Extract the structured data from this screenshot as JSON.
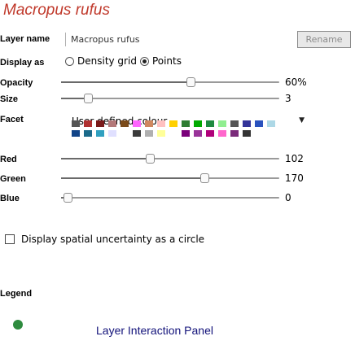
{
  "header": {
    "title": "Macropus rufus"
  },
  "layer_name": {
    "label": "Layer name",
    "value": "Macropus rufus",
    "rename_label": "Rename"
  },
  "display_as": {
    "label": "Display as",
    "options": [
      {
        "label": "Density grid",
        "checked": false
      },
      {
        "label": "Points",
        "checked": true
      }
    ]
  },
  "opacity": {
    "label": "Opacity",
    "value_text": "60%",
    "fraction": 0.6
  },
  "size": {
    "label": "Size",
    "value_text": "3",
    "fraction": 0.1
  },
  "facet": {
    "label": "Facet",
    "selected": "User defined colour"
  },
  "palette": {
    "rows": [
      [
        "#555555",
        "#b03030",
        "#7a1a1a",
        "#b47878",
        "#7a4a1a",
        "#ff66ff",
        "#d08860",
        "#ffc0c0",
        "#ffd000",
        "#2e7d32",
        "#00aa00",
        "#1e8a40",
        "#90ee90",
        "#555555",
        "#333399",
        "#2a52be",
        "#add8e6"
      ],
      [
        "#114488",
        "#1b6a8a",
        "#30a0c0",
        "#e0e0ff",
        "#ffffff",
        "#3a3a3a",
        "#b0b0b0",
        "#ffff99",
        "#ffffff",
        "#7a007a",
        "#993399",
        "#b0007a",
        "#ff66cc",
        "#7a2a7a",
        "#333333",
        "#ffffff",
        "#ffffff"
      ]
    ]
  },
  "red": {
    "label": "Red",
    "value_text": "102",
    "fraction": 0.4
  },
  "green": {
    "label": "Green",
    "value_text": "170",
    "fraction": 0.667
  },
  "blue": {
    "label": "Blue",
    "value_text": "0",
    "fraction": 0.0
  },
  "uncertainty": {
    "label": "Display spatial uncertainty as a circle",
    "checked": false
  },
  "legend": {
    "label": "Legend",
    "color": "#2e8b3e"
  },
  "footer": {
    "panel_title": "Layer Interaction Panel"
  },
  "colors": {
    "title": "#c0392b",
    "panel_title": "#12127a"
  }
}
